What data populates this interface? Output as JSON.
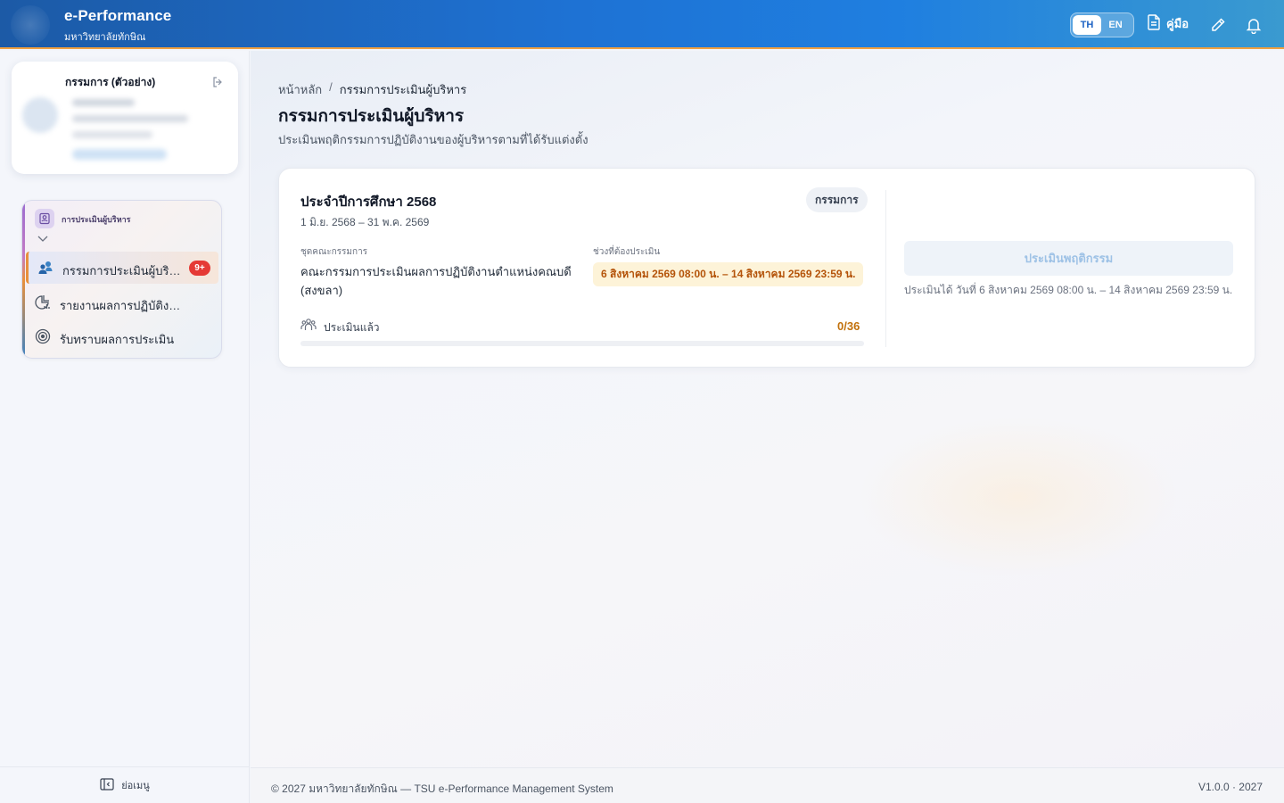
{
  "header": {
    "app_title": "e-Performance",
    "app_subtitle": "มหาวิทยาลัยทักษิณ",
    "lang_th": "TH",
    "lang_en": "EN",
    "active_lang": "TH",
    "manual_label": "คู่มือ",
    "icons": [
      "document-icon",
      "pencil-icon",
      "bell-icon"
    ]
  },
  "sidebar": {
    "profile_name": "กรรมการ (ตัวอย่าง)",
    "group_label": "การประเมินผู้บริหาร",
    "items": [
      {
        "label": "กรรมการประเมินผู้บริหาร",
        "icon": "users-icon",
        "badge": "9+",
        "active": true
      },
      {
        "label": "รายงานผลการปฏิบัติงาน",
        "icon": "report-chart-icon"
      },
      {
        "label": "รับทราบผลการประเมิน",
        "icon": "target-icon"
      }
    ],
    "collapse_label": "ย่อเมนู"
  },
  "breadcrumb": {
    "home": "หน้าหลัก",
    "separator": "/",
    "current": "กรรมการประเมินผู้บริหาร"
  },
  "page": {
    "title": "กรรมการประเมินผู้บริหาร",
    "subtitle": "ประเมินพฤติกรรมการปฏิบัติงานของผู้บริหารตามที่ได้รับแต่งตั้ง"
  },
  "card": {
    "year_title": "ประจำปีการศึกษา 2568",
    "date_range": "1 มิ.ย. 2568 – 31 พ.ค. 2569",
    "role": "กรรมการ",
    "committee_label": "ชุดคณะกรรมการ",
    "committee_value": "คณะกรรมการประเมินผลการปฏิบัติงานตำแหน่งคณบดี (สงขลา)",
    "period_label": "ช่วงที่ต้องประเมิน",
    "period_value": "6 สิงหาคม 2569 08:00 น. – 14 สิงหาคม 2569 23:59 น.",
    "progress_label": "ประเมินแล้ว",
    "progress_count": "0/36",
    "progress_fraction": 0,
    "action_label": "ประเมินพฤติกรรม",
    "action_note": "ประเมินได้ วันที่ 6 สิงหาคม 2569 08:00 น. – 14 สิงหาคม 2569 23:59 น."
  },
  "footer": {
    "copyright": "© 2027 มหาวิทยาลัยทักษิณ — TSU e-Performance Management System",
    "version": "V1.0.0 · 2027"
  },
  "colors": {
    "header_blue": "#1e72d4",
    "accent_orange": "#e8903c",
    "badge_red": "#e53935",
    "period_text": "#b45309"
  }
}
